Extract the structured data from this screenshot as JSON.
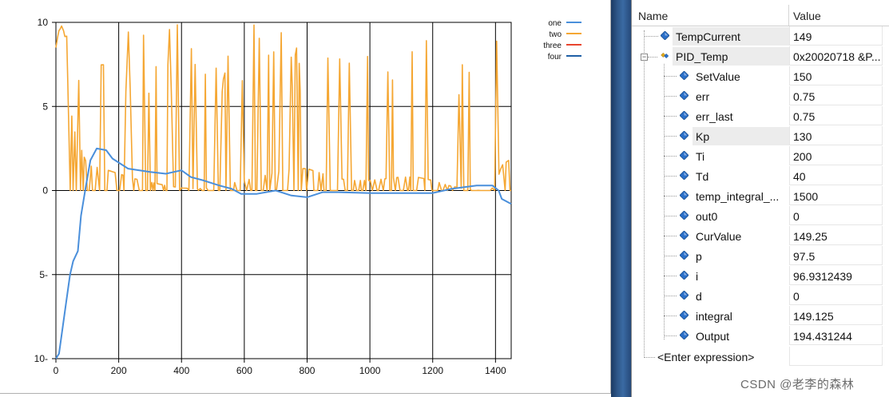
{
  "chart_data": {
    "type": "line",
    "legend_placement": "top-right",
    "xlim": [
      0,
      1450
    ],
    "ylim": [
      -10,
      10
    ],
    "x_ticks": [
      "0",
      "200",
      "400",
      "600",
      "800",
      "1000",
      "1200",
      "1400"
    ],
    "y_ticks": [
      "10",
      "5",
      "0",
      "5-",
      "10-"
    ],
    "grid": true,
    "series": [
      {
        "name": "one",
        "color": "#4a8fdb",
        "points": [
          [
            0,
            -10
          ],
          [
            10,
            -9.7
          ],
          [
            30,
            -7
          ],
          [
            45,
            -5
          ],
          [
            55,
            -4.2
          ],
          [
            70,
            -3.6
          ],
          [
            80,
            -1.5
          ],
          [
            95,
            0.2
          ],
          [
            110,
            1.8
          ],
          [
            130,
            2.5
          ],
          [
            160,
            2.4
          ],
          [
            180,
            1.9
          ],
          [
            230,
            1.3
          ],
          [
            300,
            1.1
          ],
          [
            350,
            1.0
          ],
          [
            400,
            1.2
          ],
          [
            430,
            0.8
          ],
          [
            470,
            0.6
          ],
          [
            520,
            0.3
          ],
          [
            560,
            0.1
          ],
          [
            590,
            -0.2
          ],
          [
            640,
            -0.2
          ],
          [
            700,
            0
          ],
          [
            750,
            -0.3
          ],
          [
            800,
            -0.4
          ],
          [
            850,
            -0.1
          ],
          [
            900,
            -0.1
          ],
          [
            1000,
            -0.15
          ],
          [
            1100,
            -0.15
          ],
          [
            1200,
            -0.15
          ],
          [
            1260,
            0.1
          ],
          [
            1340,
            0.3
          ],
          [
            1390,
            0.3
          ],
          [
            1410,
            0
          ],
          [
            1420,
            -0.5
          ],
          [
            1440,
            -0.7
          ],
          [
            1450,
            -0.8
          ]
        ]
      },
      {
        "name": "two",
        "color": "#f5a733",
        "points": [
          [
            0,
            8.5
          ],
          [
            15,
            10
          ],
          [
            30,
            10
          ],
          [
            40,
            5.5
          ],
          [
            60,
            3.5
          ],
          [
            80,
            2.5
          ],
          [
            100,
            1.5
          ],
          [
            150,
            1.3
          ],
          [
            200,
            1.0
          ],
          [
            250,
            0.7
          ],
          [
            300,
            0.5
          ],
          [
            350,
            0.3
          ],
          [
            400,
            0.15
          ],
          [
            450,
            0.1
          ],
          [
            500,
            0.2
          ],
          [
            550,
            0.4
          ],
          [
            600,
            0.6
          ],
          [
            650,
            0.8
          ],
          [
            700,
            1.1
          ],
          [
            750,
            1.3
          ],
          [
            800,
            1.3
          ],
          [
            850,
            1.0
          ],
          [
            900,
            0.7
          ],
          [
            950,
            0.6
          ],
          [
            1000,
            0.6
          ],
          [
            1050,
            0.7
          ],
          [
            1100,
            0.8
          ],
          [
            1150,
            0.8
          ],
          [
            1200,
            0.6
          ],
          [
            1250,
            0.3
          ],
          [
            1300,
            0.1
          ],
          [
            1350,
            0
          ],
          [
            1380,
            0
          ],
          [
            1400,
            0.3
          ],
          [
            1420,
            1.5
          ],
          [
            1450,
            1.9
          ]
        ],
        "oscillation_band": [
          0,
          10
        ]
      },
      {
        "name": "three",
        "color": "#e8452e",
        "points": []
      },
      {
        "name": "four",
        "color": "#1f5fa6",
        "points": []
      }
    ]
  },
  "watch": {
    "columns": {
      "name": "Name",
      "value": "Value"
    },
    "rows": [
      {
        "name": "TempCurrent",
        "value": "149",
        "indent": 0
      },
      {
        "name": "PID_Temp",
        "value": "0x20020718 &P...",
        "indent": 0,
        "expandable": true,
        "expanded": true
      },
      {
        "name": "SetValue",
        "value": "150",
        "indent": 1
      },
      {
        "name": "err",
        "value": "0.75",
        "indent": 1
      },
      {
        "name": "err_last",
        "value": "0.75",
        "indent": 1
      },
      {
        "name": "Kp",
        "value": "130",
        "indent": 1
      },
      {
        "name": "Ti",
        "value": "200",
        "indent": 1
      },
      {
        "name": "Td",
        "value": "40",
        "indent": 1
      },
      {
        "name": "temp_integral_...",
        "value": "1500",
        "indent": 1
      },
      {
        "name": "out0",
        "value": "0",
        "indent": 1
      },
      {
        "name": "CurValue",
        "value": "149.25",
        "indent": 1
      },
      {
        "name": "p",
        "value": "97.5",
        "indent": 1
      },
      {
        "name": "i",
        "value": "96.9312439",
        "indent": 1
      },
      {
        "name": "d",
        "value": "0",
        "indent": 1
      },
      {
        "name": "integral",
        "value": "149.125",
        "indent": 1
      },
      {
        "name": "Output",
        "value": "194.431244",
        "indent": 1
      }
    ],
    "enter_expression": "<Enter expression>"
  },
  "watermark": "CSDN @老李的森林",
  "colors": {
    "field_icon": "#2a6fc9",
    "struct_icon": "#e0a81c",
    "separator": "#2e5687"
  }
}
